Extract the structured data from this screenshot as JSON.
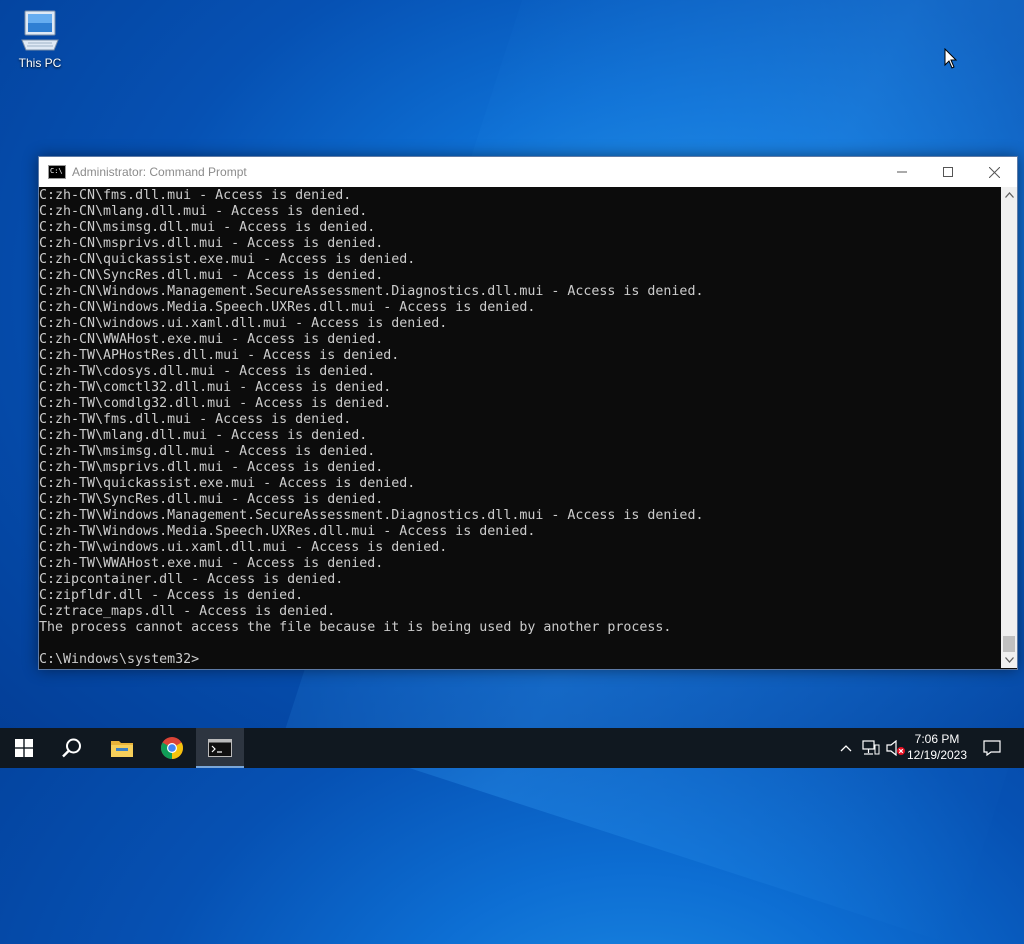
{
  "desktop": {
    "icons": [
      {
        "label": "This PC",
        "icon": "computer-icon"
      }
    ]
  },
  "window": {
    "title": "Administrator: Command Prompt",
    "icon": "cmd-icon",
    "controls": [
      "minimize-icon",
      "maximize-icon",
      "close-icon"
    ]
  },
  "console": {
    "lines": [
      "C:zh-CN\\fms.dll.mui - Access is denied.",
      "C:zh-CN\\mlang.dll.mui - Access is denied.",
      "C:zh-CN\\msimsg.dll.mui - Access is denied.",
      "C:zh-CN\\msprivs.dll.mui - Access is denied.",
      "C:zh-CN\\quickassist.exe.mui - Access is denied.",
      "C:zh-CN\\SyncRes.dll.mui - Access is denied.",
      "C:zh-CN\\Windows.Management.SecureAssessment.Diagnostics.dll.mui - Access is denied.",
      "C:zh-CN\\Windows.Media.Speech.UXRes.dll.mui - Access is denied.",
      "C:zh-CN\\windows.ui.xaml.dll.mui - Access is denied.",
      "C:zh-CN\\WWAHost.exe.mui - Access is denied.",
      "C:zh-TW\\APHostRes.dll.mui - Access is denied.",
      "C:zh-TW\\cdosys.dll.mui - Access is denied.",
      "C:zh-TW\\comctl32.dll.mui - Access is denied.",
      "C:zh-TW\\comdlg32.dll.mui - Access is denied.",
      "C:zh-TW\\fms.dll.mui - Access is denied.",
      "C:zh-TW\\mlang.dll.mui - Access is denied.",
      "C:zh-TW\\msimsg.dll.mui - Access is denied.",
      "C:zh-TW\\msprivs.dll.mui - Access is denied.",
      "C:zh-TW\\quickassist.exe.mui - Access is denied.",
      "C:zh-TW\\SyncRes.dll.mui - Access is denied.",
      "C:zh-TW\\Windows.Management.SecureAssessment.Diagnostics.dll.mui - Access is denied.",
      "C:zh-TW\\Windows.Media.Speech.UXRes.dll.mui - Access is denied.",
      "C:zh-TW\\windows.ui.xaml.dll.mui - Access is denied.",
      "C:zh-TW\\WWAHost.exe.mui - Access is denied.",
      "C:zipcontainer.dll - Access is denied.",
      "C:zipfldr.dll - Access is denied.",
      "C:ztrace_maps.dll - Access is denied.",
      "The process cannot access the file because it is being used by another process.",
      "",
      "C:\\Windows\\system32>"
    ],
    "scroll_position": 1.0
  },
  "taskbar": {
    "items": [
      {
        "name": "start-button",
        "icon": "windows-logo-icon"
      },
      {
        "name": "search-button",
        "icon": "search-icon"
      },
      {
        "name": "file-explorer-button",
        "icon": "folder-icon"
      },
      {
        "name": "chrome-button",
        "icon": "chrome-icon"
      },
      {
        "name": "command-prompt-button",
        "icon": "cmd-icon",
        "active": true
      }
    ],
    "tray": {
      "icons": [
        "chevron-up-icon",
        "network-icon",
        "volume-muted-icon"
      ],
      "time": "7:06 PM",
      "date": "12/19/2023",
      "notification_icon": "notification-icon"
    }
  },
  "colors": {
    "console_bg": "#0c0c0c",
    "console_text": "#cccccc",
    "taskbar_bg": "#101820"
  }
}
